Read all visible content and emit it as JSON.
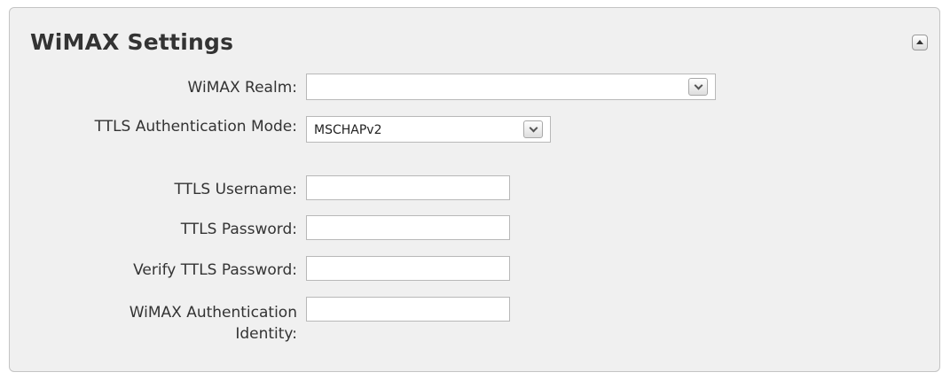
{
  "panel": {
    "title": "WiMAX Settings",
    "collapse_icon": "triangle-up-icon"
  },
  "form": {
    "wimax_realm": {
      "label": "WiMAX Realm:",
      "value": ""
    },
    "ttls_auth_mode": {
      "label": "TTLS Authentication Mode:",
      "value": "MSCHAPv2"
    },
    "ttls_username": {
      "label": "TTLS Username:",
      "value": ""
    },
    "ttls_password": {
      "label": "TTLS Password:",
      "value": ""
    },
    "verify_ttls_password": {
      "label": "Verify TTLS Password:",
      "value": ""
    },
    "wimax_auth_identity": {
      "label": "WiMAX Authentication Identity:",
      "value": ""
    }
  }
}
